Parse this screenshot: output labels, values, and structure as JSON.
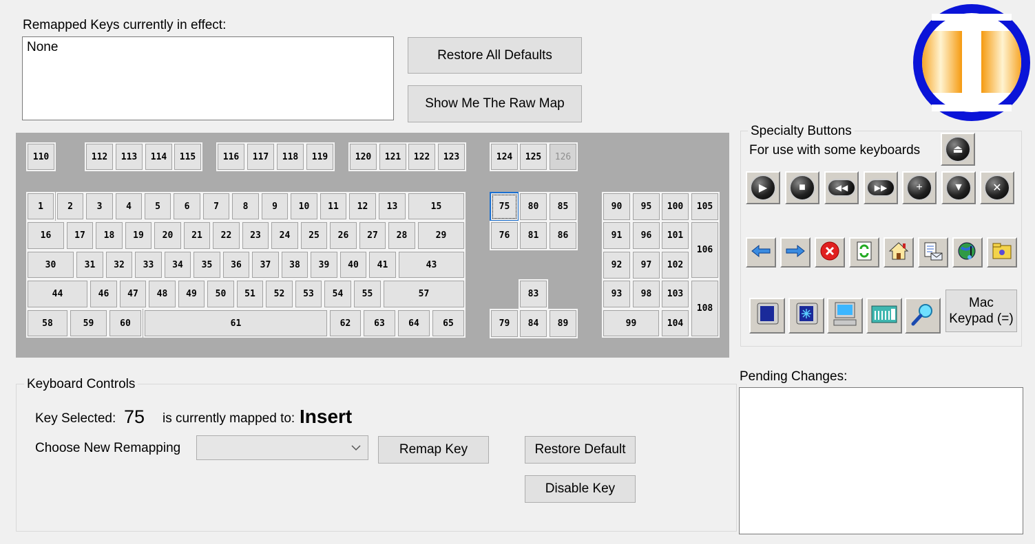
{
  "remapped": {
    "label": "Remapped Keys currently in effect:",
    "value": "None"
  },
  "top_buttons": {
    "restore_all": "Restore All Defaults",
    "raw_map": "Show Me The Raw Map"
  },
  "logo": {
    "name": "app-logo",
    "colors": {
      "ring": "#0a14d8",
      "inner": "#ffffff",
      "accent": "#f5a623"
    }
  },
  "keyboard": {
    "fn_row": [
      "110",
      "112",
      "113",
      "114",
      "115",
      "116",
      "117",
      "118",
      "119",
      "120",
      "121",
      "122",
      "123",
      "124",
      "125",
      "126"
    ],
    "disabled_keys": [
      "126"
    ],
    "selected_key": "75",
    "row1": [
      "1",
      "2",
      "3",
      "4",
      "5",
      "6",
      "7",
      "8",
      "9",
      "10",
      "11",
      "12",
      "13",
      "15"
    ],
    "row2": [
      "16",
      "17",
      "18",
      "19",
      "20",
      "21",
      "22",
      "23",
      "24",
      "25",
      "26",
      "27",
      "28",
      "29"
    ],
    "row3": [
      "30",
      "31",
      "32",
      "33",
      "34",
      "35",
      "36",
      "37",
      "38",
      "39",
      "40",
      "41",
      "43"
    ],
    "row4": [
      "44",
      "46",
      "47",
      "48",
      "49",
      "50",
      "51",
      "52",
      "53",
      "54",
      "55",
      "57"
    ],
    "row5": [
      "58",
      "59",
      "60",
      "61",
      "62",
      "63",
      "64",
      "65"
    ],
    "nav": [
      "75",
      "80",
      "85",
      "76",
      "81",
      "86",
      "83",
      "79",
      "84",
      "89"
    ],
    "numpad": [
      "90",
      "95",
      "100",
      "105",
      "91",
      "96",
      "101",
      "106",
      "92",
      "97",
      "102",
      "93",
      "98",
      "103",
      "108",
      "99",
      "104"
    ]
  },
  "specialty": {
    "title": "Specialty Buttons",
    "subtitle": "For use with some keyboards",
    "eject": "eject-icon",
    "media": [
      "play-icon",
      "stop-icon",
      "rewind-icon",
      "fast-forward-icon",
      "volume-up-icon",
      "volume-down-icon",
      "mute-icon"
    ],
    "browser": [
      "back-arrow-icon",
      "forward-arrow-icon",
      "stop-red-icon",
      "refresh-icon",
      "home-icon",
      "mail-icon",
      "media-globe-icon",
      "folder-icon"
    ],
    "system": [
      "sleep-monitor-icon",
      "wake-monitor-icon",
      "my-computer-icon",
      "calculator-icon",
      "search-magnifier-icon"
    ],
    "mac_keypad": "Mac\nKeypad (=)"
  },
  "controls": {
    "title": "Keyboard Controls",
    "key_selected_label": "Key Selected:",
    "key_selected_value": "75",
    "mapped_label": "is currently mapped to:",
    "mapped_value": "Insert",
    "choose_label": "Choose New Remapping",
    "choose_value": "",
    "remap_button": "Remap Key",
    "restore_default_button": "Restore Default",
    "disable_button": "Disable Key"
  },
  "pending": {
    "label": "Pending Changes:",
    "value": ""
  }
}
